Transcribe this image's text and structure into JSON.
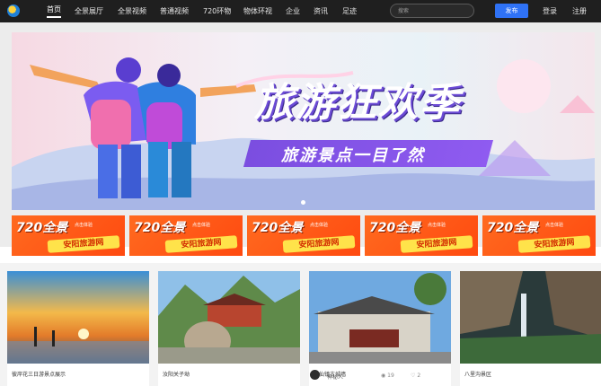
{
  "nav": {
    "items": [
      "首页",
      "全景展厅",
      "全景视频",
      "普通视频",
      "720环物",
      "物体环视",
      "企业",
      "资讯",
      "足迹"
    ],
    "active_index": 0
  },
  "header": {
    "search_placeholder": "搜索",
    "publish_label": "发布",
    "login_label": "登录",
    "register_label": "注册"
  },
  "banner": {
    "title": "旅游狂欢季",
    "subtitle": "旅游景点一目了然"
  },
  "promos": [
    {
      "main": "720全景",
      "brand": "安阳旅游网",
      "tag": "点击体验"
    },
    {
      "main": "720全景",
      "brand": "安阳旅游网",
      "tag": "点击体验"
    },
    {
      "main": "720全景",
      "brand": "安阳旅游网",
      "tag": "点击体验"
    },
    {
      "main": "720全景",
      "brand": "安阳旅游网",
      "tag": "点击体验"
    },
    {
      "main": "720全景",
      "brand": "安阳旅游网",
      "tag": "点击体验"
    }
  ],
  "gallery": [
    {
      "caption": "彼岸花三日游景点展示"
    },
    {
      "caption": "汝阳关子坳"
    },
    {
      "caption": "朱仙镇古城墙",
      "author": "神秘人",
      "views": "19",
      "likes": "2"
    },
    {
      "caption": "八里沟景区"
    }
  ],
  "colors": {
    "accent": "#2f72f5",
    "topbar": "#1f1f1f",
    "promo": "#ff5a18"
  }
}
